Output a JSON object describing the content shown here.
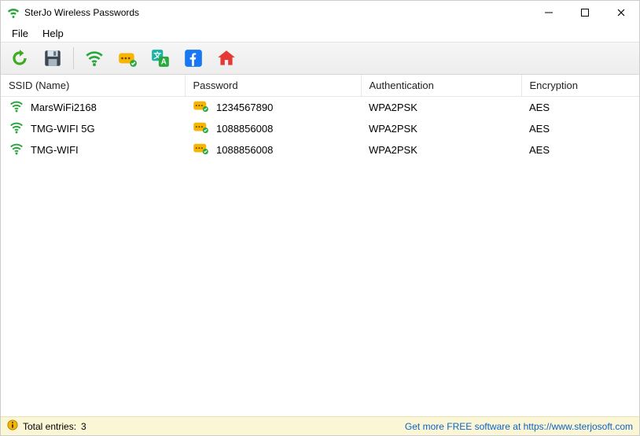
{
  "window": {
    "title": "SterJo Wireless Passwords"
  },
  "menu": {
    "file": "File",
    "help": "Help"
  },
  "columns": {
    "ssid": "SSID (Name)",
    "password": "Password",
    "auth": "Authentication",
    "enc": "Encryption"
  },
  "rows": [
    {
      "ssid": "MarsWiFi2168",
      "password": "1234567890",
      "auth": "WPA2PSK",
      "enc": "AES"
    },
    {
      "ssid": "TMG-WIFI 5G",
      "password": "1088856008",
      "auth": "WPA2PSK",
      "enc": "AES"
    },
    {
      "ssid": "TMG-WIFI",
      "password": "1088856008",
      "auth": "WPA2PSK",
      "enc": "AES"
    }
  ],
  "status": {
    "prefix": "Total entries:",
    "count": "3",
    "link": "Get more FREE software at https://www.sterjosoft.com"
  }
}
